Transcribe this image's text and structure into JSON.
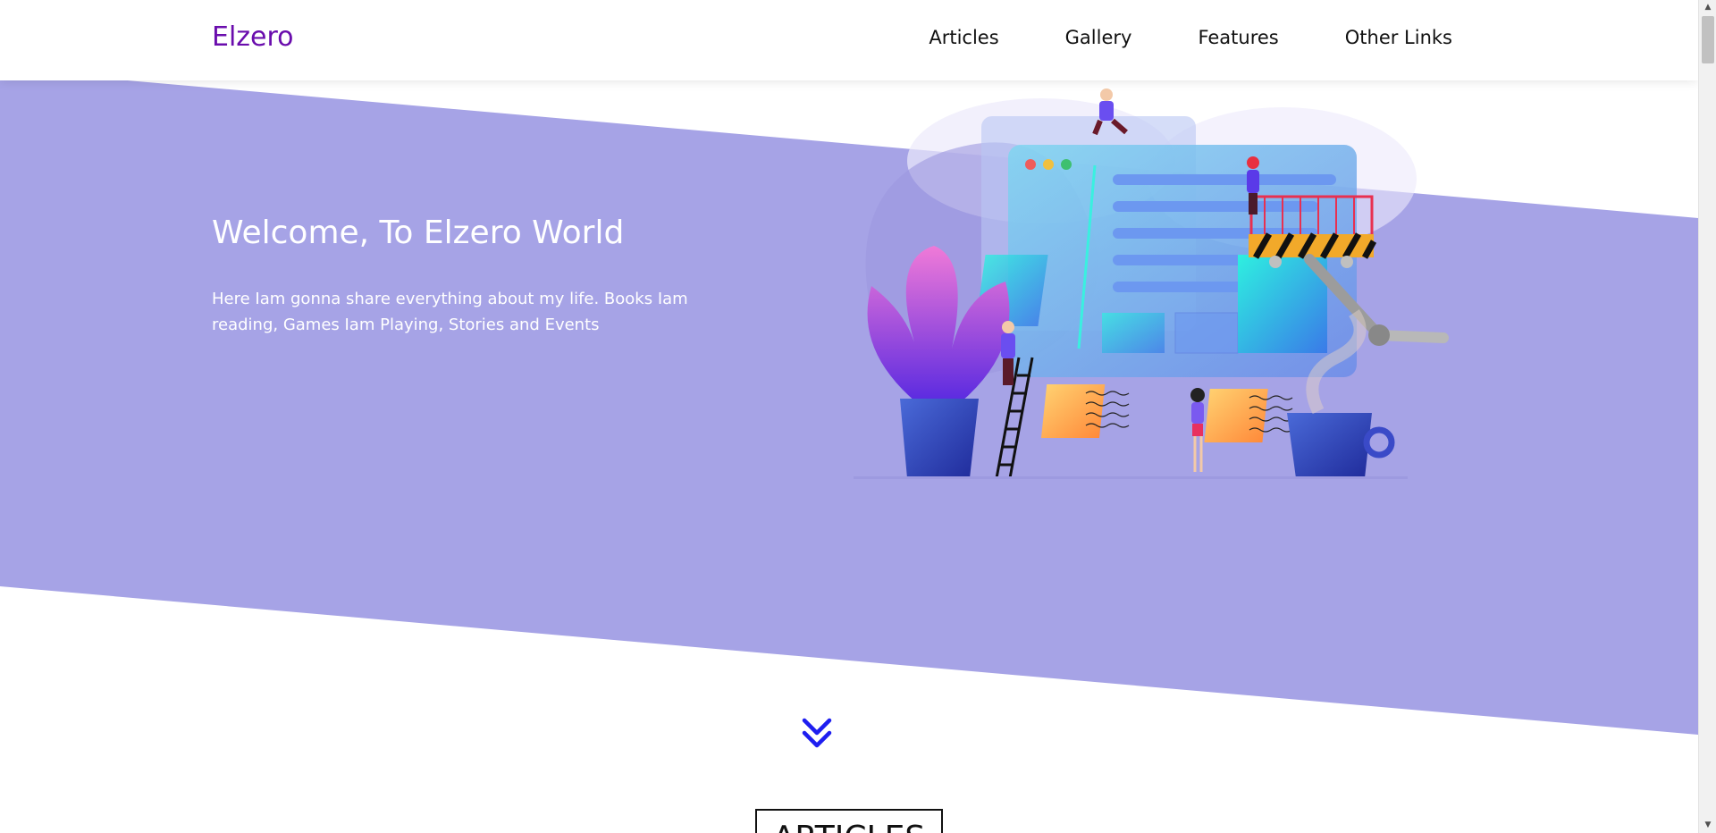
{
  "header": {
    "logo": "Elzero",
    "nav": [
      {
        "label": "Articles"
      },
      {
        "label": "Gallery"
      },
      {
        "label": "Features"
      },
      {
        "label": "Other Links"
      }
    ]
  },
  "hero": {
    "title": "Welcome, To Elzero World",
    "text": "Here Iam gonna share everything about my life. Books Iam reading, Games Iam Playing, Stories and Events"
  },
  "articles": {
    "heading": "ARTICLES"
  },
  "colors": {
    "brand": "#6a0dad",
    "hero_bg": "#a6a3e6",
    "arrow": "#1e1ef0"
  }
}
